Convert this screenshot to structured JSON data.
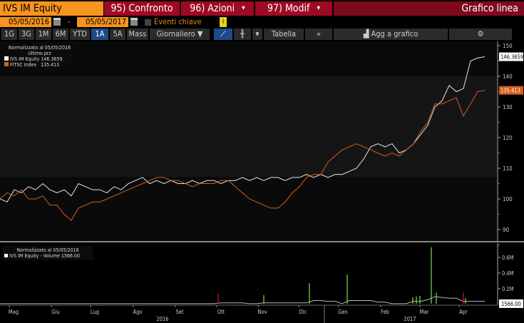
{
  "header": {
    "ticker": "IVS IM Equity",
    "compare": "95) Confronto",
    "actions": "96) Azioni",
    "modify": "97) Modif",
    "chart_type": "Grafico linea"
  },
  "dates": {
    "start": "05/05/2016",
    "sep": "-",
    "end": "05/05/2017",
    "events_label": "Eventi chiave",
    "info": "i"
  },
  "toolbar": {
    "periods": [
      "1G",
      "3G",
      "1M",
      "6M",
      "YTD",
      "1A",
      "5A",
      "Mass"
    ],
    "selected": "1A",
    "frequency": "Giornaliero ▼",
    "table": "Tabella",
    "back": "«",
    "add": "Agg a grafico",
    "dropdown": "▾"
  },
  "colors": {
    "ivs": "#e8e8e8",
    "ftsc": "#d2601a",
    "accent": "#f7931e",
    "red": "#9c0a24",
    "vol_up": "#7ce050",
    "vol_down": "#d0202a"
  },
  "legend": {
    "title": "Normalizzato al 05/05/2016",
    "subtitle": "Ultimo prz",
    "items": [
      {
        "name": "IVS IM Equity",
        "value": "146.3659"
      },
      {
        "name": "FITSC Index",
        "value": "135.413"
      }
    ]
  },
  "vol_legend": {
    "title": "Normalizzato al 05/05/2016",
    "item": "IVS IM Equity - Volume 1566.00"
  },
  "chart_data": [
    {
      "type": "line",
      "title": "Normalizzato al 05/05/2016",
      "ylim": [
        87,
        152
      ],
      "yticks": [
        90,
        100,
        110,
        120,
        130,
        140,
        150
      ],
      "last_labels": [
        "146.3659",
        "135.413"
      ],
      "series": [
        {
          "name": "IVS IM Equity",
          "values": [
            100,
            99,
            103,
            102,
            104,
            103,
            105,
            103,
            102,
            103,
            101,
            105,
            104,
            103,
            103,
            102,
            104,
            103,
            105,
            106,
            107,
            105,
            106,
            105,
            106,
            105,
            105,
            106,
            105,
            106,
            106,
            105,
            106,
            106,
            107,
            106,
            107,
            106,
            107,
            107,
            106,
            107,
            107,
            108,
            107,
            108,
            107,
            108,
            108,
            109,
            110,
            113,
            117,
            118,
            117,
            118,
            115,
            116,
            118,
            121,
            124,
            130,
            132,
            137,
            135,
            136,
            145,
            146,
            146.3659
          ]
        },
        {
          "name": "FITSC Index",
          "values": [
            100,
            102,
            101,
            103,
            100,
            100,
            101,
            98,
            98,
            95,
            93,
            97,
            98,
            99,
            99,
            100,
            101,
            102,
            103,
            104,
            105,
            106,
            107,
            107,
            106,
            106,
            105,
            104,
            105,
            105,
            105,
            106,
            106,
            104,
            102,
            100,
            99,
            98,
            97,
            97,
            99,
            102,
            104,
            107,
            108,
            108,
            112,
            114,
            116,
            117,
            118,
            117,
            116,
            115,
            114,
            115,
            114,
            116,
            118,
            122,
            125,
            131,
            131,
            132,
            133,
            127,
            131,
            135,
            135.413
          ]
        }
      ]
    },
    {
      "type": "bar",
      "title": "IVS IM Equity - Volume",
      "ylim": [
        0,
        0.8
      ],
      "yticks": [
        "0.2M",
        "0.4M",
        "0.6M"
      ],
      "last_label": "1566.00",
      "spikes": [
        {
          "i": 30.6,
          "v": 0.14,
          "dir": "down"
        },
        {
          "i": 37,
          "v": 0.12,
          "dir": "up"
        },
        {
          "i": 43.4,
          "v": 0.27,
          "dir": "up"
        },
        {
          "i": 48.7,
          "v": 0.38,
          "dir": "up"
        },
        {
          "i": 57.9,
          "v": 0.09,
          "dir": "up"
        },
        {
          "i": 58.4,
          "v": 0.1,
          "dir": "up"
        },
        {
          "i": 58.9,
          "v": 0.11,
          "dir": "up"
        },
        {
          "i": 60.5,
          "v": 0.73,
          "dir": "up"
        },
        {
          "i": 61.2,
          "v": 0.15,
          "dir": "up"
        },
        {
          "i": 65,
          "v": 0.15,
          "dir": "down"
        },
        {
          "i": 65.3,
          "v": 0.08,
          "dir": "up"
        }
      ],
      "avg": [
        0.01,
        0.01,
        0.01,
        0.01,
        0.01,
        0.01,
        0.01,
        0.01,
        0.01,
        0.01,
        0.01,
        0.01,
        0.01,
        0.01,
        0.01,
        0.01,
        0.01,
        0.01,
        0.01,
        0.01,
        0.01,
        0.01,
        0.01,
        0.01,
        0.01,
        0.01,
        0.01,
        0.01,
        0.01,
        0.01,
        0.01,
        0.02,
        0.02,
        0.02,
        0.02,
        0.01,
        0.01,
        0.02,
        0.02,
        0.02,
        0.02,
        0.02,
        0.02,
        0.02,
        0.05,
        0.05,
        0.04,
        0.04,
        0.01,
        0.05,
        0.05,
        0.05,
        0.05,
        0.03,
        0.03,
        0.01,
        0.01,
        0.01,
        0.04,
        0.04,
        0.06,
        0.1,
        0.09,
        0.08,
        0.08,
        0.04,
        0.04,
        0.04,
        0.04
      ]
    },
    {
      "type": "axis",
      "months": [
        "Mag",
        "Giu",
        "Lug",
        "Ago",
        "Set",
        "Ott",
        "Nov",
        "Dic",
        "Gen",
        "Feb",
        "Mar",
        "Apr"
      ],
      "years": [
        "2016",
        "2017"
      ]
    }
  ]
}
